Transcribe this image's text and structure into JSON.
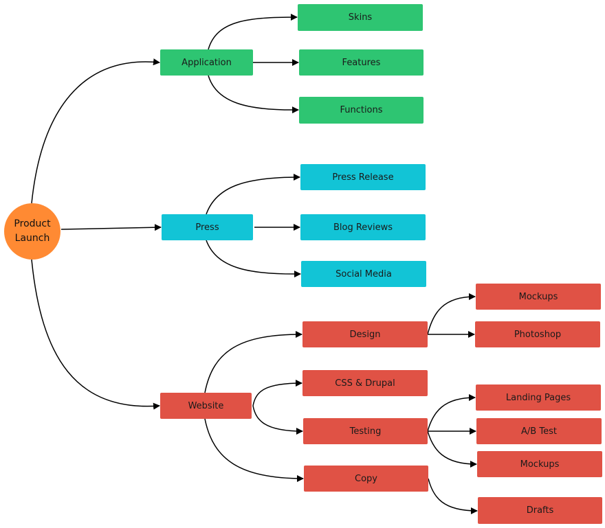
{
  "diagram": {
    "title": "Product Launch",
    "colors": {
      "root": "#FF8A33",
      "application": "#2EC572",
      "press": "#12C4D6",
      "website": "#E05245",
      "edge": "#000000"
    },
    "root": {
      "id": "root",
      "label": "Product\nLaunch"
    },
    "branches": [
      {
        "id": "application",
        "label": "Application",
        "color_key": "application",
        "children": [
          {
            "id": "skins",
            "label": "Skins"
          },
          {
            "id": "features",
            "label": "Features"
          },
          {
            "id": "functions",
            "label": "Functions"
          }
        ]
      },
      {
        "id": "press",
        "label": "Press",
        "color_key": "press",
        "children": [
          {
            "id": "press-release",
            "label": "Press Release"
          },
          {
            "id": "blog-reviews",
            "label": "Blog Reviews"
          },
          {
            "id": "social-media",
            "label": "Social Media"
          }
        ]
      },
      {
        "id": "website",
        "label": "Website",
        "color_key": "website",
        "children": [
          {
            "id": "design",
            "label": "Design",
            "children": [
              {
                "id": "design-mockups",
                "label": "Mockups"
              },
              {
                "id": "photoshop",
                "label": "Photoshop"
              }
            ]
          },
          {
            "id": "css-drupal",
            "label": "CSS & Drupal"
          },
          {
            "id": "testing",
            "label": "Testing",
            "children": [
              {
                "id": "landing-pages",
                "label": "Landing Pages"
              },
              {
                "id": "ab-test",
                "label": "A/B Test"
              },
              {
                "id": "testing-mockups",
                "label": "Mockups"
              }
            ]
          },
          {
            "id": "copy",
            "label": "Copy",
            "children": [
              {
                "id": "drafts",
                "label": "Drafts"
              }
            ]
          }
        ]
      }
    ]
  }
}
